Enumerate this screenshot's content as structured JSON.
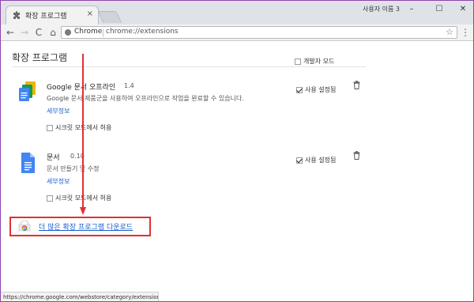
{
  "tab": {
    "title": "확장 프로그램",
    "close_glyph": "×"
  },
  "profile": {
    "name": "사용자 이름 3"
  },
  "window_controls": {
    "minimize": "–",
    "maximize": "☐",
    "close": "✕"
  },
  "toolbar": {
    "back": "←",
    "forward": "→",
    "reload": "C",
    "home": "⌂",
    "chip": "Chrome",
    "url": "chrome://extensions",
    "star": "☆",
    "menu": "⋮"
  },
  "page": {
    "title": "확장 프로그램",
    "developer_mode_label": "개발자 모드",
    "developer_mode_checked": false
  },
  "extensions": [
    {
      "name": "Google 문서 오프라인",
      "version": "1.4",
      "description": "Google 문서 제품군을 사용하여 오프라인으로 작업을 완료할 수 있습니다.",
      "details_link": "세부정보",
      "incognito_label": "시크릿 모드에서 허용",
      "incognito_checked": false,
      "enabled_label": "사용 설정됨",
      "enabled_checked": true
    },
    {
      "name": "문서",
      "version": "0.10",
      "description": "문서 만들기 및 수정",
      "details_link": "세부정보",
      "incognito_label": "시크릿 모드에서 허용",
      "incognito_checked": false,
      "enabled_label": "사용 설정됨",
      "enabled_checked": true
    }
  ],
  "more_extensions_link": "더 많은 확장 프로그램 다운로드",
  "statusbar": {
    "url": "https://chrome.google.com/webstore/category/extension..."
  },
  "colors": {
    "highlight": "#e23030",
    "link": "#1a5fcc",
    "window_border": "#8e44ad"
  }
}
